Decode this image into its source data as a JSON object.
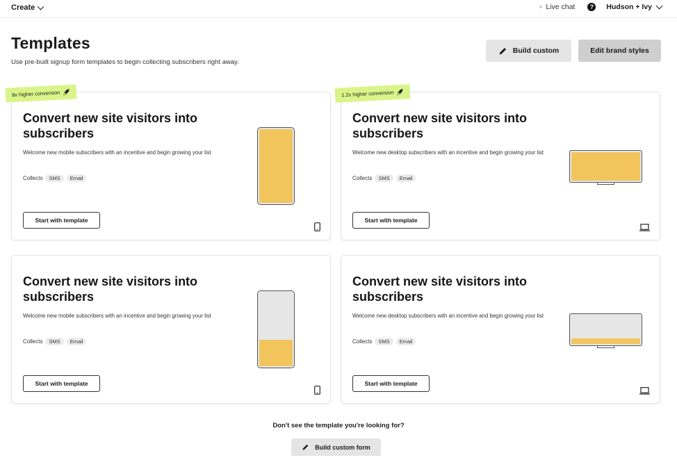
{
  "topbar": {
    "create_label": "Create",
    "live_chat_label": "Live chat",
    "help_symbol": "?",
    "account_label": "Hudson + Ivy"
  },
  "header": {
    "title": "Templates",
    "subtitle": "Use pre-built signup form templates to begin collecting subscribers right away.",
    "build_custom_label": "Build custom",
    "brand_styles_label": "Edit brand styles"
  },
  "cards": [
    {
      "badge": "8x higher conversion",
      "title": "Convert new site visitors into subscribers",
      "description": "Welcome new mobile subscribers with an incentive and begin growing your list",
      "collects_label": "Collects",
      "chips": [
        "SMS",
        "Email"
      ],
      "button_label": "Start with template",
      "device": "mobile",
      "preview_fill": 1.0
    },
    {
      "badge": "1.2x higher conversion",
      "title": "Convert new site visitors into subscribers",
      "description": "Welcome new desktop subscribers with an incentive and begin growing your list",
      "collects_label": "Collects",
      "chips": [
        "SMS",
        "Email"
      ],
      "button_label": "Start with template",
      "device": "desktop",
      "preview_fill": 1.0
    },
    {
      "badge": "",
      "title": "Convert new site visitors into subscribers",
      "description": "Welcome new mobile subscribers with an incentive and begin growing your list",
      "collects_label": "Collects",
      "chips": [
        "SMS",
        "Email"
      ],
      "button_label": "Start with template",
      "device": "mobile",
      "preview_fill": 0.38
    },
    {
      "badge": "",
      "title": "Convert new site visitors into subscribers",
      "description": "Welcome new desktop subscribers with an incentive and begin growing your list",
      "collects_label": "Collects",
      "chips": [
        "SMS",
        "Email"
      ],
      "button_label": "Start with template",
      "device": "desktop",
      "preview_fill": 0.27
    }
  ],
  "footer": {
    "prompt": "Don't see the template you're looking for?",
    "button_label": "Build custom form"
  },
  "colors": {
    "accent_fill": "#f2c55c",
    "badge_bg": "#d9f589",
    "button_gray": "#e5e5e5"
  },
  "icons": {
    "rocket": "rocket-icon",
    "pencil": "pencil-icon",
    "mobile": "mobile-device-icon",
    "desktop": "laptop-device-icon"
  }
}
